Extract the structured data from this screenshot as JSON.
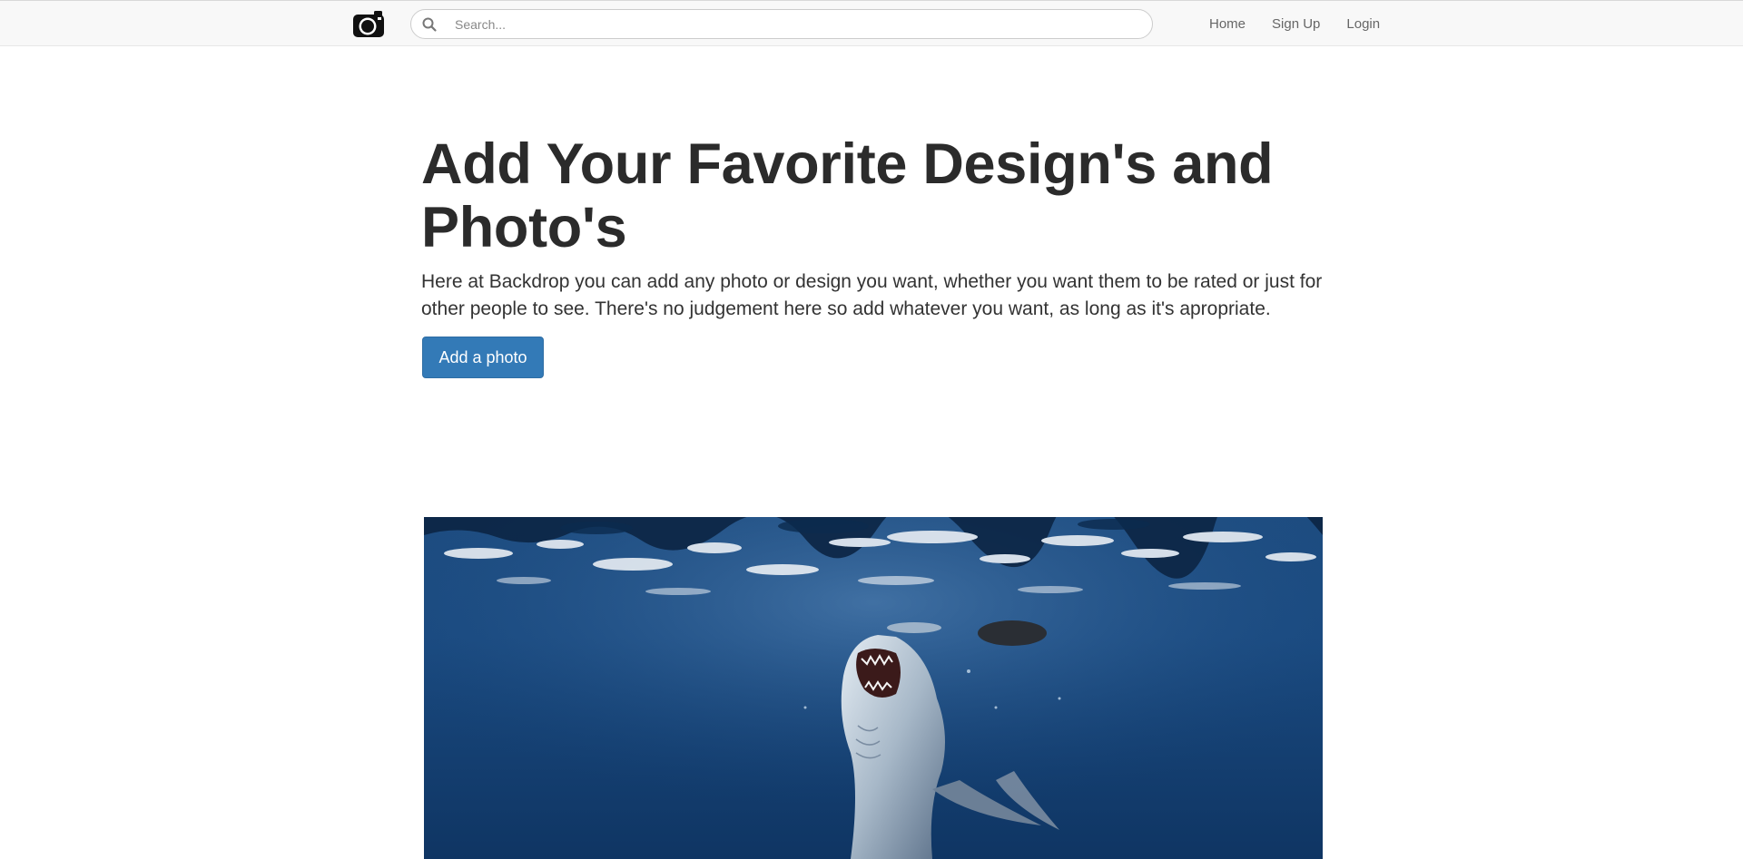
{
  "navbar": {
    "brand_icon": "camera-icon",
    "search": {
      "icon": "search-icon",
      "placeholder": "Search...",
      "value": ""
    },
    "links": [
      {
        "label": "Home"
      },
      {
        "label": "Sign Up"
      },
      {
        "label": "Login"
      }
    ]
  },
  "hero": {
    "title": "Add Your Favorite Design's and Photo's",
    "text": "Here at Backdrop you can add any photo or design you want, whether you want them to be rated or just for other people to see. There's no judgement here so add whatever you want, as long as it's apropriate.",
    "button_label": "Add a photo"
  },
  "featured_photo": {
    "subject": "underwater shark photograph"
  },
  "colors": {
    "navbar_bg": "#f8f8f8",
    "primary": "#337ab7",
    "title_text": "#2b2b2b",
    "ocean_deep": "#143c6b"
  }
}
